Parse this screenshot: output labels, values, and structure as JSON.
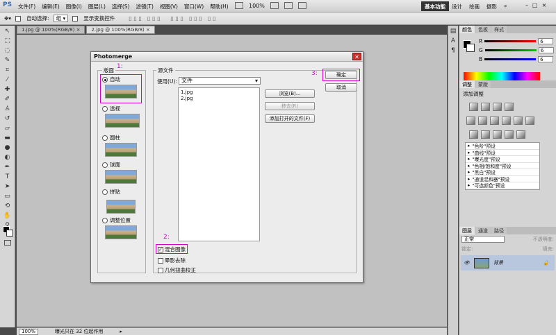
{
  "app": {
    "logo": "PS"
  },
  "menubar": {
    "items": [
      "文件(F)",
      "编辑(E)",
      "图像(I)",
      "图层(L)",
      "选择(S)",
      "滤镜(T)",
      "视图(V)",
      "窗口(W)",
      "帮助(H)"
    ],
    "zoom": "100%",
    "workspaces": {
      "active": "基本功能",
      "others": [
        "设计",
        "绘画",
        "摄影"
      ],
      "more": "»"
    },
    "window_controls": [
      "–",
      "□",
      "×"
    ]
  },
  "options_bar": {
    "auto_select_label": "自动选择:",
    "auto_select_value": "组",
    "show_transform_label": "显示变换控件"
  },
  "doc_tabs": [
    {
      "label": "1.jpg @ 100%(RGB/8)",
      "close": "×"
    },
    {
      "label": "2.jpg @ 100%(RGB/8)",
      "close": "×"
    }
  ],
  "status_bar": {
    "zoom": "100%",
    "info": "曝光只在 32 位起作用"
  },
  "dialog": {
    "title": "Photomerge",
    "close": "✕",
    "layout": {
      "legend": "版面",
      "options": [
        {
          "label": "自动",
          "selected": true
        },
        {
          "label": "透视",
          "selected": false
        },
        {
          "label": "圆柱",
          "selected": false
        },
        {
          "label": "球面",
          "selected": false
        },
        {
          "label": "拼贴",
          "selected": false
        },
        {
          "label": "调整位置",
          "selected": false
        }
      ]
    },
    "source": {
      "legend": "源文件",
      "use_label": "使用(U):",
      "use_value": "文件",
      "files": [
        "1.jpg",
        "2.jpg"
      ],
      "browse": "浏览(B)...",
      "remove": "移去(R)",
      "add_open": "添加打开的文件(F)",
      "blend_images": {
        "label": "混合图像",
        "checked": true
      },
      "vignette_removal": {
        "label": "晕影去除",
        "checked": false
      },
      "geometric_distortion": {
        "label": "几何扭曲校正",
        "checked": false
      }
    },
    "ok": "确定",
    "cancel": "取消",
    "annotations": [
      "1:",
      "2:",
      "3:"
    ]
  },
  "color_panel": {
    "tabs": [
      "颜色",
      "色板",
      "样式"
    ],
    "r": {
      "label": "R",
      "value": "6"
    },
    "g": {
      "label": "G",
      "value": "6"
    },
    "b": {
      "label": "B",
      "value": "6"
    }
  },
  "adjustments_panel": {
    "tabs": [
      "调整",
      "蒙版"
    ],
    "title": "添加调整",
    "presets": [
      "\"色阶\"预设",
      "\"曲线\"预设",
      "\"曝光度\"预设",
      "\"色相/饱和度\"预设",
      "\"黑白\"预设",
      "\"通道混和器\"预设",
      "\"可选颜色\"预设"
    ]
  },
  "layers_panel": {
    "tabs": [
      "图层",
      "通道",
      "路径"
    ],
    "blend_mode": "正常",
    "opacity_label": "不透明度:",
    "lock_label": "锁定:",
    "fill_label": "填充:",
    "layer_name": "背景"
  },
  "colors": {
    "annotation": "#d400c8",
    "selected_layer": "#b8c6de"
  }
}
